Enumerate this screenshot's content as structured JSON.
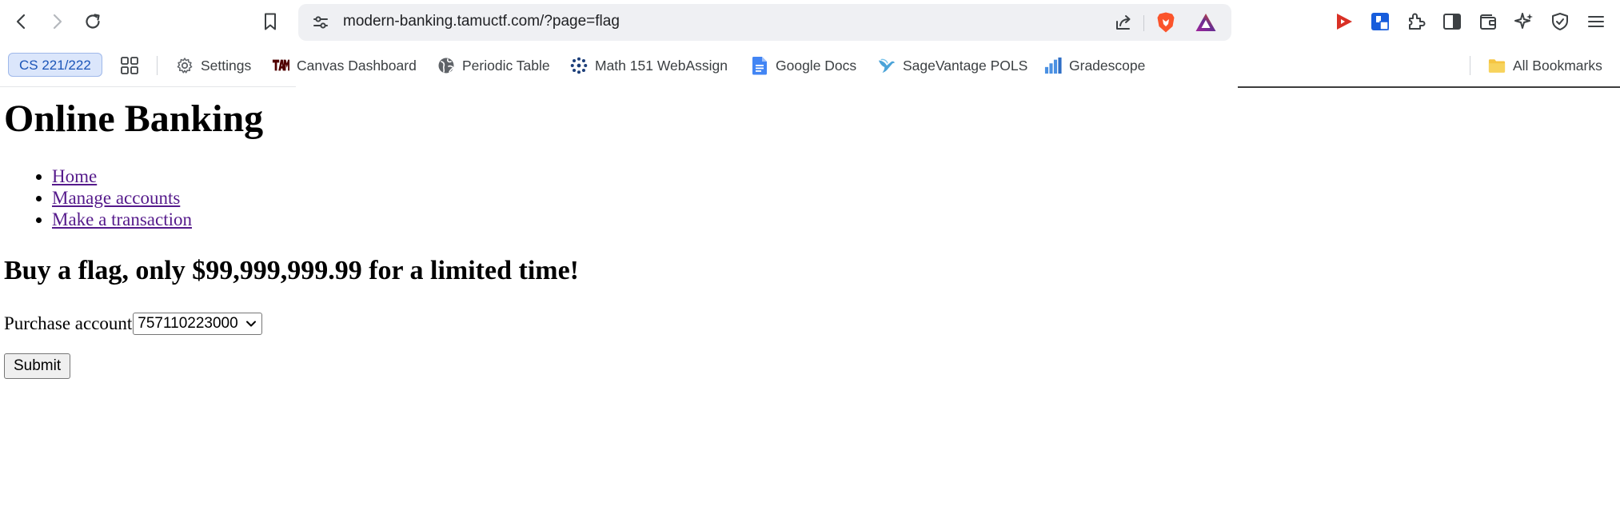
{
  "browser": {
    "url": "modern-banking.tamuctf.com/?page=flag",
    "bookmarks": {
      "group_label": "CS 221/222",
      "items": [
        {
          "label": "Settings",
          "icon": "gear-icon"
        },
        {
          "label": "Canvas Dashboard",
          "icon": "tamu-logo-icon"
        },
        {
          "label": "Periodic Table",
          "icon": "globe-icon"
        },
        {
          "label": "Math 151 WebAssign",
          "icon": "webassign-icon"
        },
        {
          "label": "Google Docs",
          "icon": "google-docs-icon"
        },
        {
          "label": "SageVantage POLS",
          "icon": "bird-icon"
        },
        {
          "label": "Gradescope",
          "icon": "bar-chart-icon"
        }
      ],
      "all_bookmarks_label": "All Bookmarks"
    },
    "colors": {
      "group_bg": "#dbe6fb",
      "group_text": "#1b55b8",
      "brave_orange": "#fb542b",
      "link_visited": "#551a8b"
    }
  },
  "page": {
    "title": "Online Banking",
    "nav": [
      {
        "label": "Home"
      },
      {
        "label": "Manage accounts"
      },
      {
        "label": "Make a transaction"
      }
    ],
    "offer_heading": "Buy a flag, only $99,999,999.99 for a limited time!",
    "purchase_label": "Purchase account",
    "account_selected": "757110223000",
    "submit_label": "Submit"
  }
}
